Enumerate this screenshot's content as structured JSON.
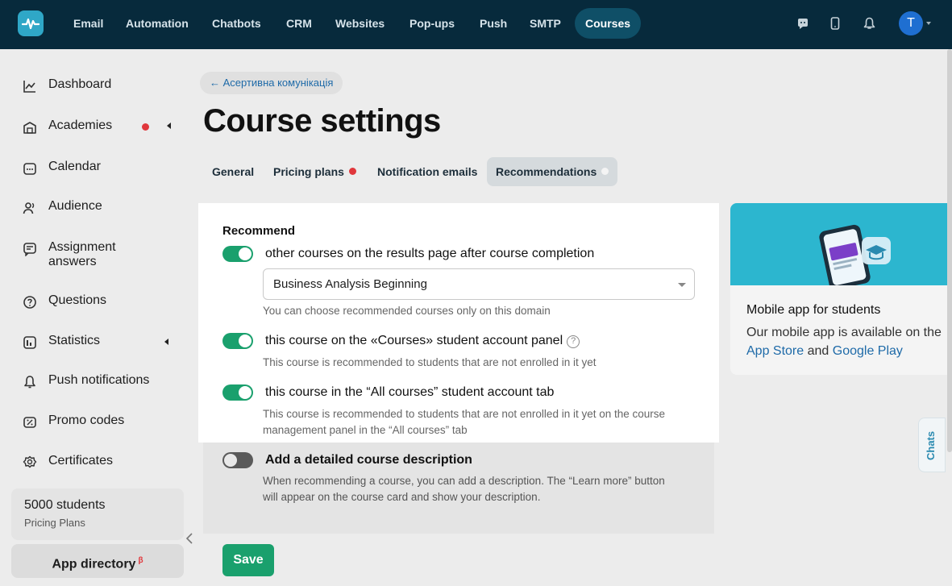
{
  "topnav": {
    "items": [
      "Email",
      "Automation",
      "Chatbots",
      "CRM",
      "Websites",
      "Pop-ups",
      "Push",
      "SMTP",
      "Courses"
    ],
    "active": "Courses",
    "avatar_initial": "T"
  },
  "sidebar": {
    "items": [
      {
        "label": "Dashboard",
        "icon": "chart-icon"
      },
      {
        "label": "Academies",
        "icon": "academy-icon"
      },
      {
        "label": "Calendar",
        "icon": "calendar-icon"
      },
      {
        "label": "Audience",
        "icon": "users-icon"
      },
      {
        "label": "Assignment answers",
        "icon": "assignment-icon"
      },
      {
        "label": "Questions",
        "icon": "question-icon"
      },
      {
        "label": "Statistics",
        "icon": "statistics-icon"
      },
      {
        "label": "Push notifications",
        "icon": "bell-icon"
      },
      {
        "label": "Promo codes",
        "icon": "promo-icon"
      },
      {
        "label": "Certificates",
        "icon": "certificate-icon"
      }
    ],
    "plan": {
      "title": "5000 students",
      "subtitle": "Pricing Plans"
    },
    "app_directory": "App directory",
    "app_directory_badge": "β"
  },
  "main": {
    "back_link": "← Асертивна комунікація",
    "title": "Course settings",
    "tabs": [
      {
        "label": "General"
      },
      {
        "label": "Pricing plans"
      },
      {
        "label": "Notification emails"
      },
      {
        "label": "Recommendations"
      }
    ],
    "active_tab": "Recommendations"
  },
  "recommend": {
    "heading": "Recommend",
    "option1": {
      "label": "other courses on the results page after course completion",
      "enabled": true
    },
    "select": {
      "value": "Business Analysis Beginning"
    },
    "select_hint": "You can choose recommended courses only on this domain",
    "option2": {
      "label": "this course on the «Courses» student account panel",
      "enabled": true,
      "hint": "This course is recommended to students that are not enrolled in it yet"
    },
    "option3": {
      "label": "this course in the “All courses” student account tab",
      "enabled": true,
      "hint": "This course is recommended to students that are not enrolled in it yet on the course management panel in the “All courses” tab"
    },
    "option4": {
      "label": "Add a detailed course description",
      "enabled": false,
      "hint": "When recommending a course, you can add a description. The “Learn more” button will appear on the course card and show your description."
    },
    "save_label": "Save"
  },
  "promo": {
    "title": "Mobile app for students",
    "text": "Our mobile app is available on the",
    "link1": "App Store",
    "and": "and",
    "link2": "Google Play"
  },
  "chats_label": "Chats",
  "colors": {
    "accent": "#1aa06d",
    "nav_bg": "#072a3c",
    "link": "#1e6aa8",
    "alert": "#e0373c"
  }
}
